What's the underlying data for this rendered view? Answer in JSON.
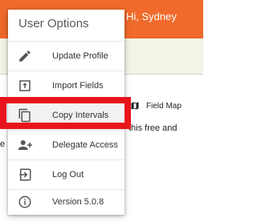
{
  "header": {
    "greeting": "Hi, Sydney"
  },
  "field_map": {
    "label": "Field Map",
    "icon": "map-icon"
  },
  "background_text": {
    "line1": "this free and",
    "line2": "e"
  },
  "user_menu": {
    "title": "User Options",
    "items": [
      {
        "label": "Update Profile",
        "icon": "pencil-icon"
      },
      {
        "label": "Import Fields",
        "icon": "upload-tray-icon"
      },
      {
        "label": "Copy Intervals",
        "icon": "copy-icon",
        "highlighted": true
      },
      {
        "label": "Delegate Access",
        "icon": "person-add-icon"
      },
      {
        "label": "Log Out",
        "icon": "logout-icon"
      },
      {
        "label": "Version 5.0.8",
        "icon": "info-icon"
      }
    ]
  },
  "colors": {
    "header_bg": "#ef6a2b",
    "highlight_frame": "#e8141c",
    "banner_bg": "#f3f4e8"
  }
}
